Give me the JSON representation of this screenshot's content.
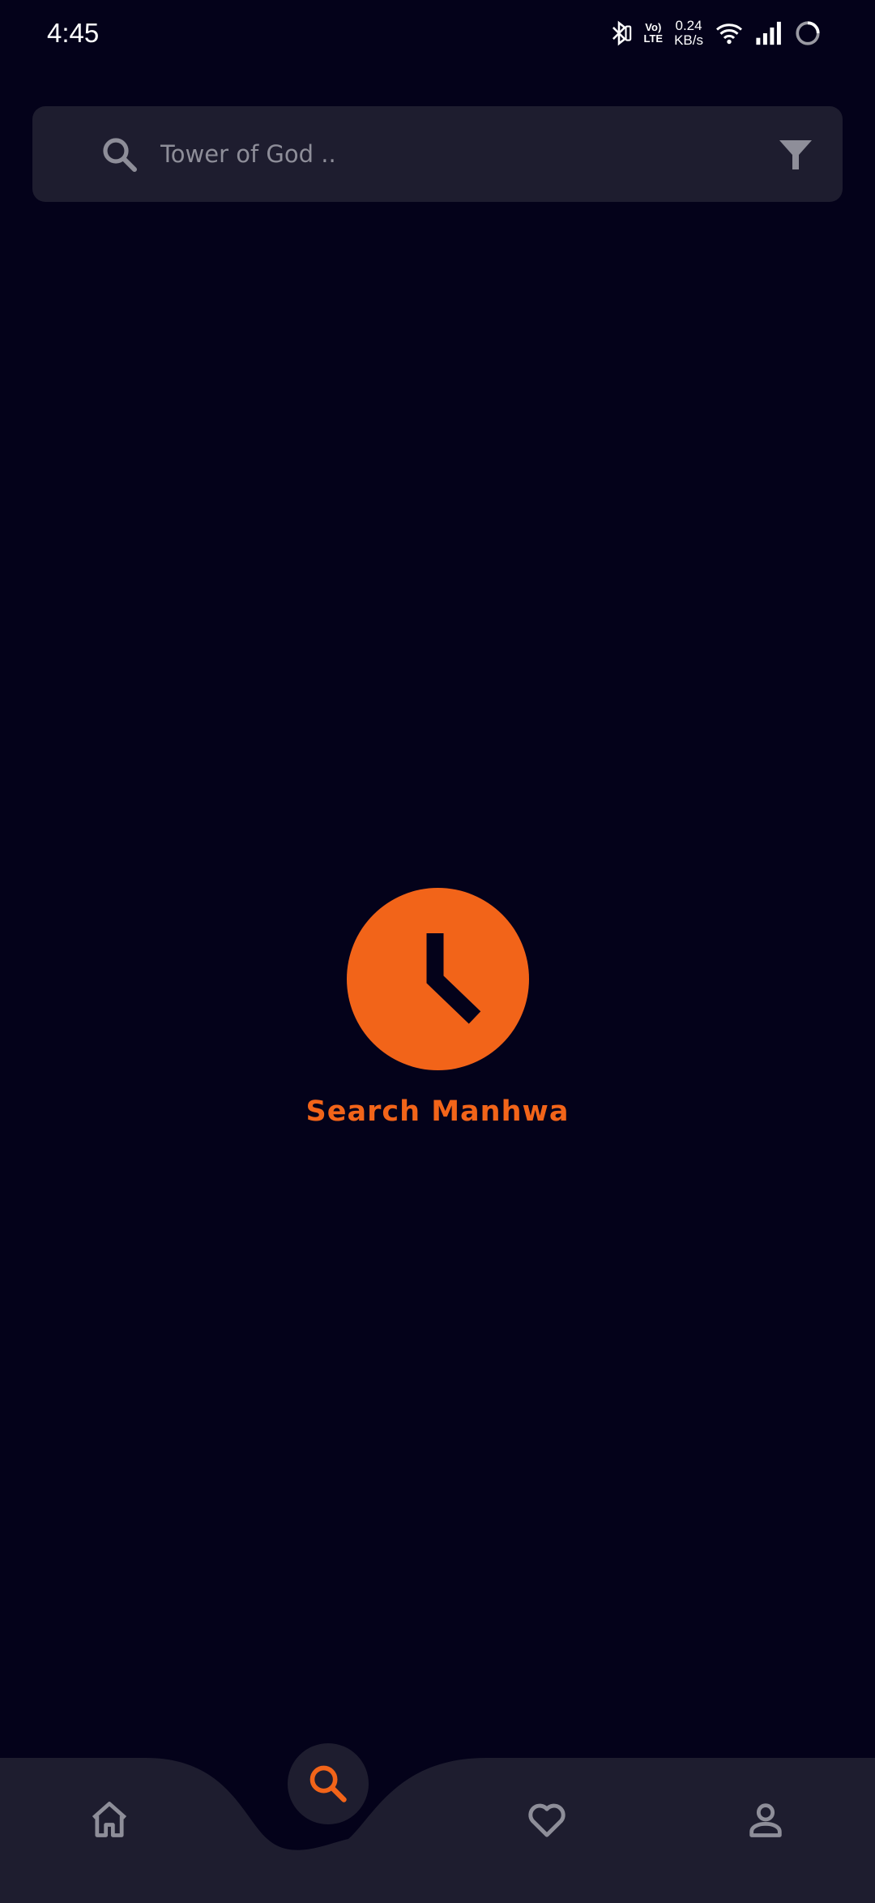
{
  "status_bar": {
    "time": "4:45",
    "network_line1": "Vo)",
    "network_line2": "LTE",
    "speed_value": "0.24",
    "speed_unit": "KB/s"
  },
  "search": {
    "placeholder": "Tower of God .."
  },
  "empty_state": {
    "title": "Search Manhwa",
    "icon": "clock-icon"
  },
  "bottom_nav": {
    "items": [
      {
        "icon": "home-icon"
      },
      {
        "icon": "search-icon",
        "active": true
      },
      {
        "icon": "heart-icon"
      },
      {
        "icon": "person-icon"
      }
    ]
  },
  "colors": {
    "background": "#04021a",
    "surface": "#1e1d2f",
    "accent": "#f26419",
    "icon_muted": "#8e8e99"
  }
}
